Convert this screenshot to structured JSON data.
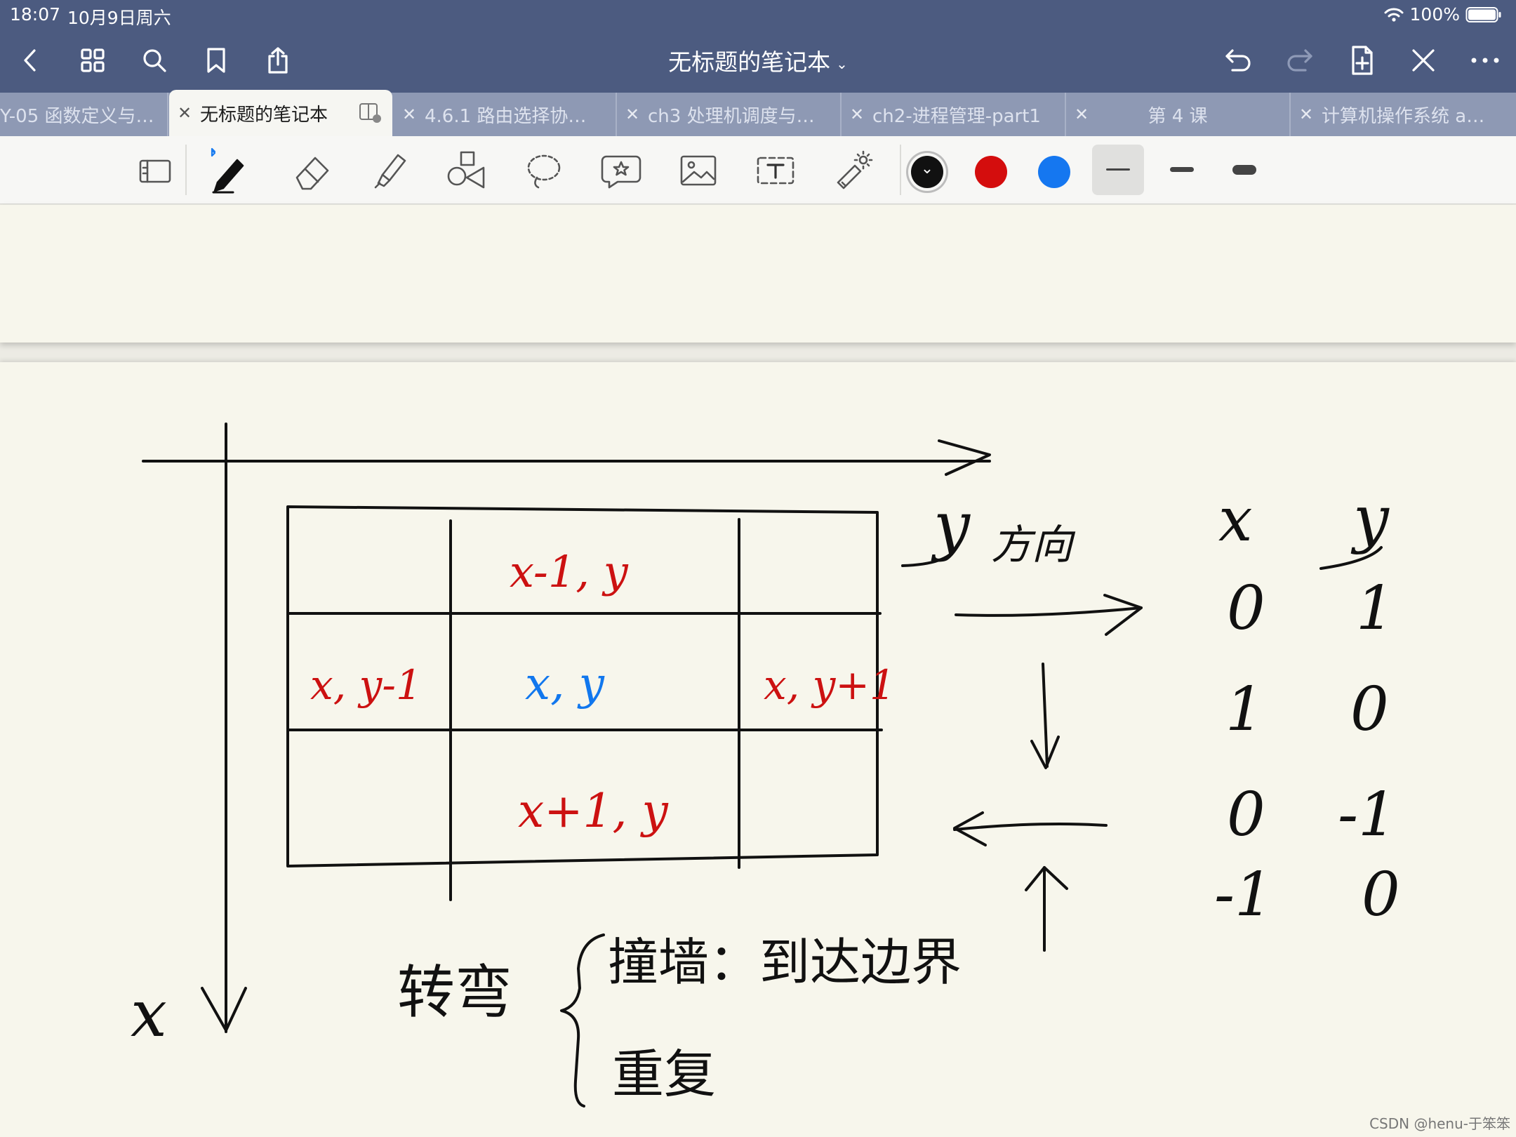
{
  "status_bar": {
    "time": "18:07",
    "date": "10月9日周六",
    "battery": "100%"
  },
  "header": {
    "title": "无标题的笔记本"
  },
  "icons": {
    "back": "chevron-left-icon",
    "grid": "grid-icon",
    "search": "search-icon",
    "bookmark": "bookmark-icon",
    "share": "share-icon",
    "undo": "undo-icon",
    "redo": "redo-icon",
    "add_page": "add-page-icon",
    "pen_off": "pen-off-icon",
    "more": "more-icon"
  },
  "tabs": [
    {
      "label": "Y-05 函数定义与…"
    },
    {
      "label": "无标题的笔记本"
    },
    {
      "label": "4.6.1 路由选择协…"
    },
    {
      "label": "ch3 处理机调度与…"
    },
    {
      "label": "ch2-进程管理-part1"
    },
    {
      "label": "第 4 课"
    },
    {
      "label": "计算机操作系统 a…"
    }
  ],
  "colors": {
    "accent": "#4c5b80",
    "ink_black": "#111111",
    "ink_red": "#cc1111",
    "ink_blue": "#1177ee",
    "page_bg": "#f7f6ec"
  },
  "notes": {
    "y_axis_label": "y",
    "y_dir_label": "方向",
    "x_axis_label": "x",
    "cell_top": "x-1, y",
    "cell_left": "x, y-1",
    "cell_center": "x, y",
    "cell_right": "x, y+1",
    "cell_bottom": "x+1, y",
    "table_header_x": "x",
    "table_header_y": "y",
    "rows": [
      {
        "x": "0",
        "y": "1"
      },
      {
        "x": "1",
        "y": "0"
      },
      {
        "x": "0",
        "y": "-1"
      },
      {
        "x": "-1",
        "y": "0"
      }
    ],
    "turn_label": "转弯",
    "case_1": "撞墙：到达边界",
    "case_2": "重复"
  },
  "watermark": "CSDN @henu-于笨笨"
}
